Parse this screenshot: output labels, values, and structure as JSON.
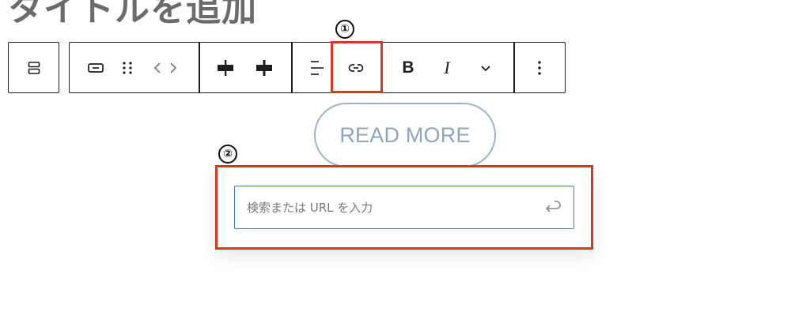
{
  "page": {
    "title": "タイトルを追加"
  },
  "toolbar": {
    "block_type_icon": "buttons-block-icon",
    "tools": [
      {
        "name": "button-block",
        "icon": "button-block-icon"
      },
      {
        "name": "drag-handle",
        "icon": "drag-handle-icon"
      },
      {
        "name": "move-arrows",
        "icon": "chevron-left-right-icon"
      },
      {
        "name": "justify-center",
        "icon": "justify-center-icon"
      },
      {
        "name": "justify-space-between",
        "icon": "justify-space-between-icon"
      },
      {
        "name": "align-text",
        "icon": "align-left-icon"
      },
      {
        "name": "link",
        "icon": "link-icon"
      },
      {
        "name": "bold",
        "icon": "bold-icon"
      },
      {
        "name": "italic",
        "icon": "italic-icon"
      },
      {
        "name": "more-rich-text",
        "icon": "chevron-down-icon"
      },
      {
        "name": "options",
        "icon": "more-vertical-icon"
      }
    ],
    "bold_label": "B",
    "italic_label": "I"
  },
  "button_block": {
    "label": "READ MORE"
  },
  "link_popover": {
    "input_placeholder": "検索または URL を入力",
    "input_value": "",
    "submit_icon": "enter-arrow-icon"
  },
  "callouts": [
    {
      "number": "①",
      "target": "link-button"
    },
    {
      "number": "②",
      "target": "link-popover"
    }
  ],
  "colors": {
    "callout": "#d23a23",
    "input_border": "#3f7bbf",
    "button_outline": "#9fb3c8",
    "button_text": "#8fa5bb",
    "title": "#6b6b6b"
  }
}
